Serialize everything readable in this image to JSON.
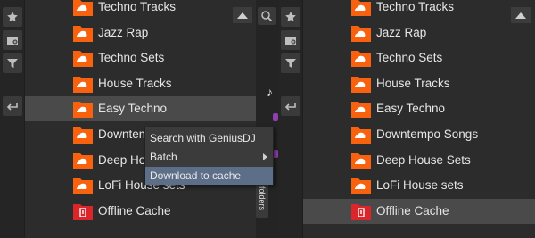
{
  "left_panel": {
    "items": [
      {
        "label": "Techno Tracks",
        "type": "soundcloud"
      },
      {
        "label": "Jazz Rap",
        "type": "soundcloud"
      },
      {
        "label": "Techno Sets",
        "type": "soundcloud"
      },
      {
        "label": "House Tracks",
        "type": "soundcloud"
      },
      {
        "label": "Easy Techno",
        "type": "soundcloud"
      },
      {
        "label": "Downtempo Songs",
        "type": "soundcloud"
      },
      {
        "label": "Deep House Sets",
        "type": "soundcloud"
      },
      {
        "label": "LoFi House sets",
        "type": "soundcloud"
      },
      {
        "label": "Offline Cache",
        "type": "cache"
      }
    ],
    "selected_index": 4
  },
  "context_menu": {
    "items": [
      {
        "label": "Search with GeniusDJ",
        "has_submenu": false
      },
      {
        "label": "Batch",
        "has_submenu": true
      },
      {
        "label": "Download to cache",
        "has_submenu": false
      }
    ],
    "active_index": 2
  },
  "folders_tab": {
    "label": "folders"
  },
  "right_panel": {
    "items": [
      {
        "label": "Techno Tracks",
        "type": "soundcloud"
      },
      {
        "label": "Jazz Rap",
        "type": "soundcloud"
      },
      {
        "label": "Techno Sets",
        "type": "soundcloud"
      },
      {
        "label": "House Tracks",
        "type": "soundcloud"
      },
      {
        "label": "Easy Techno",
        "type": "soundcloud"
      },
      {
        "label": "Downtempo Songs",
        "type": "soundcloud"
      },
      {
        "label": "Deep House Sets",
        "type": "soundcloud"
      },
      {
        "label": "LoFi House sets",
        "type": "soundcloud"
      },
      {
        "label": "Offline Cache",
        "type": "cache"
      }
    ],
    "selected_index": 8
  },
  "toolbar": {
    "icons": [
      "star-icon",
      "add-folder-icon",
      "filter-icon",
      "back-arrow-icon"
    ]
  },
  "colors": {
    "soundcloud_orange": "#f7620e",
    "cache_red": "#d9262b",
    "menu_highlight": "#5d6f88"
  }
}
